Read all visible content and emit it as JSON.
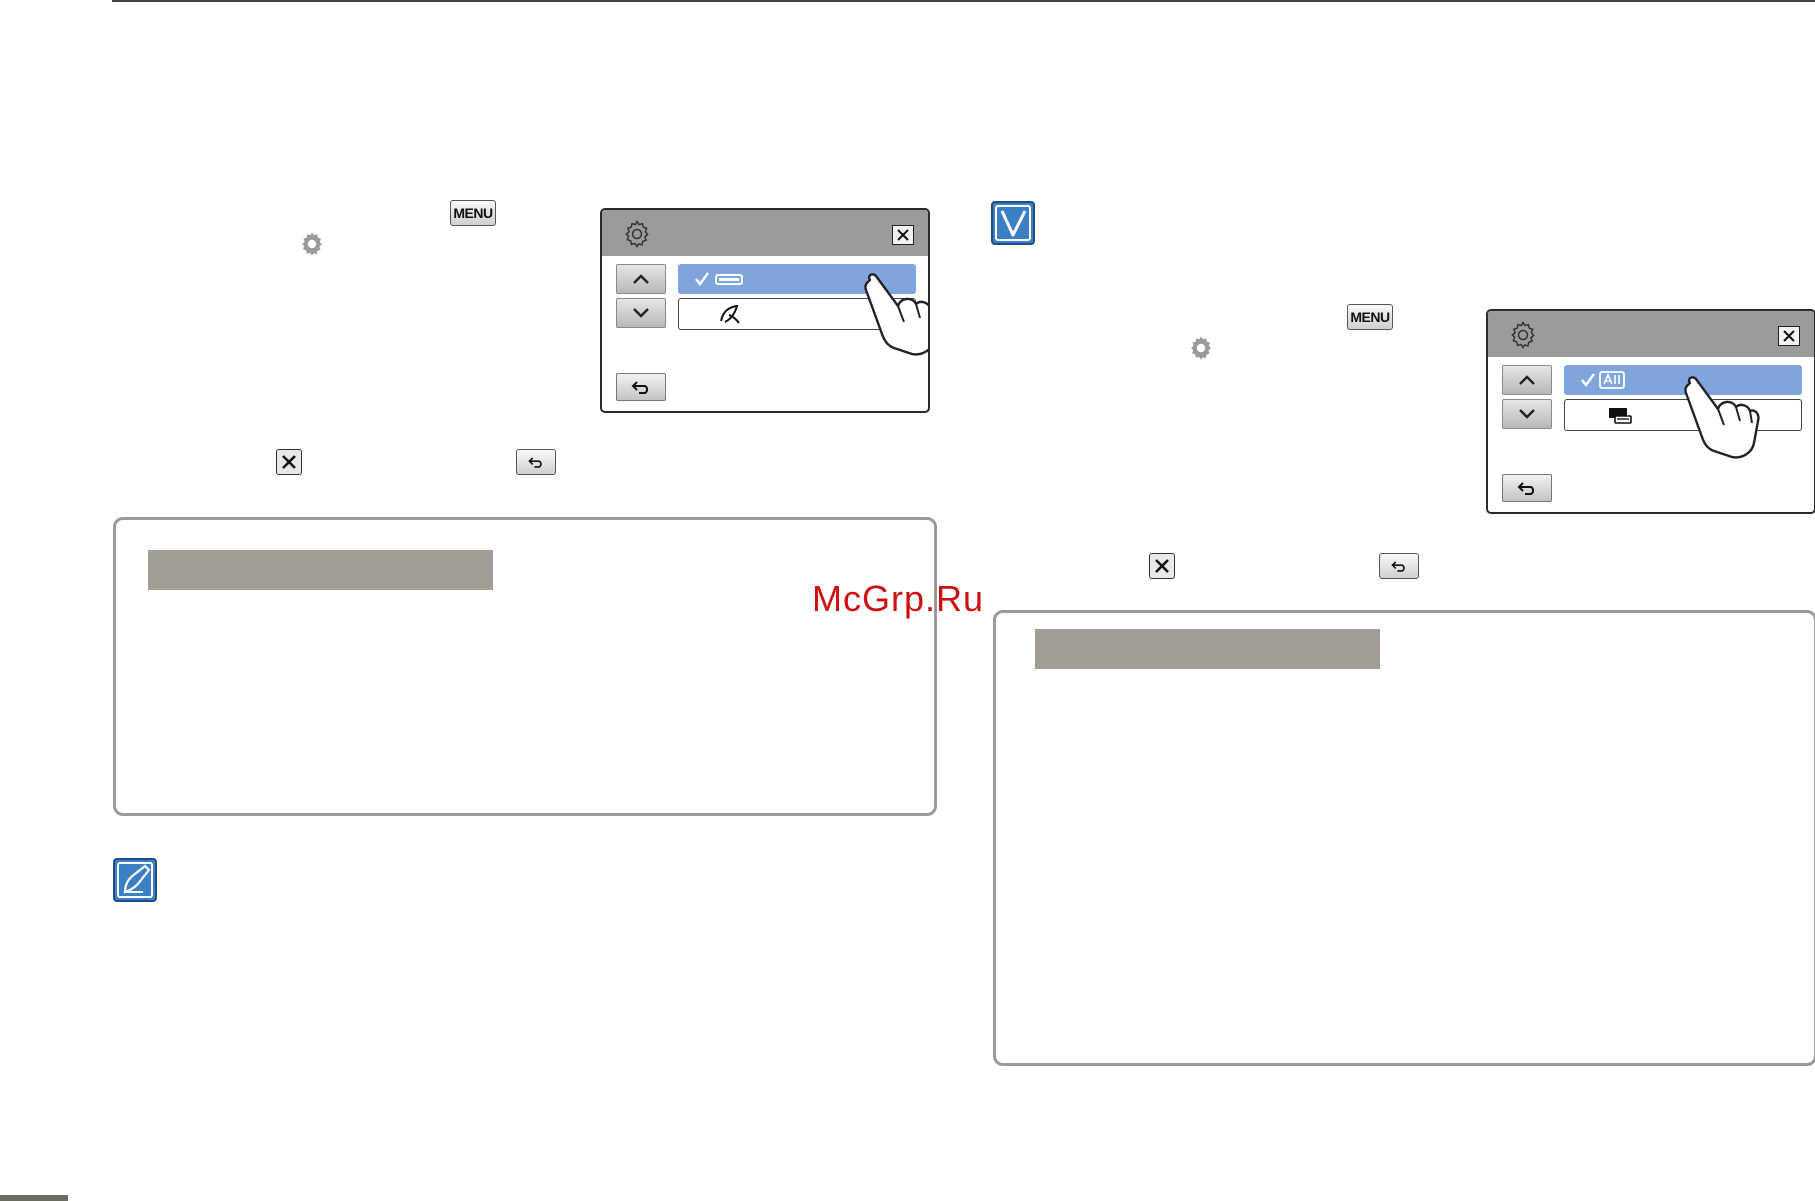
{
  "left_step": {
    "menu_key_label": "MENU"
  },
  "right_step": {
    "menu_key_label": "MENU"
  },
  "watermark": "McGrp.Ru",
  "colors": {
    "selected_option": "#7ea6dc",
    "screen_header": "#9a9b9d",
    "info_bar": "#a19d95",
    "badge_blue": "#3b7fc4",
    "watermark": "#cc1111"
  },
  "icons": {
    "settings": "gear-icon",
    "close": "close-icon",
    "back": "back-arrow-icon",
    "up": "chevron-up-icon",
    "down": "chevron-down-icon",
    "pointer": "hand-pointer-icon",
    "check_badge": "checkmark-badge-icon",
    "note_badge": "note-pencil-icon"
  }
}
